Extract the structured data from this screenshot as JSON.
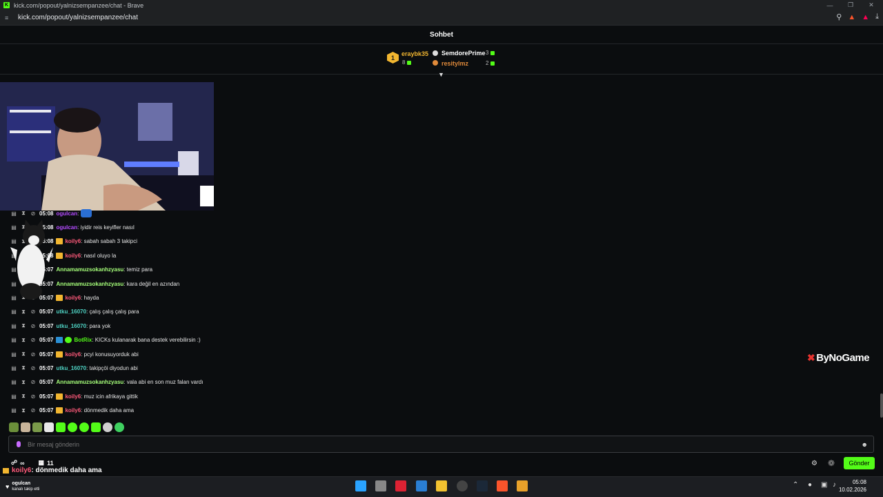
{
  "browser": {
    "title": "kick.com/popout/yalnizsempanzee/chat - Brave",
    "url": "kick.com/popout/yalnizsempanzee/chat"
  },
  "chat": {
    "header": "Sohbet",
    "leaderboard": {
      "rank": "1",
      "top": {
        "name": "eraybk35",
        "count": "8"
      },
      "second": {
        "name": "SemdorePrime",
        "count": "3"
      },
      "third": {
        "name": "resitylmz",
        "count": "2"
      }
    },
    "messages": [
      {
        "time": "05:08",
        "user": "ogulcan",
        "text": "",
        "color": "#b44cff",
        "badge": "none"
      },
      {
        "time": "05:08",
        "user": "ogulcan",
        "text": "iyidir reis keyifler nasıl",
        "color": "#b44cff",
        "badge": "none"
      },
      {
        "time": "05:08",
        "user": "koily6",
        "text": "sabah sabah 3 takipci",
        "color": "#ff5a7a",
        "badge": "crown"
      },
      {
        "time": "05:08",
        "user": "koily6",
        "text": "nasıl oluyo la",
        "color": "#ff5a7a",
        "badge": "crown"
      },
      {
        "time": "05:07",
        "user": "Annamamuzsokanhzyasu",
        "text": "temiz para",
        "color": "#a6ff7a",
        "badge": "none"
      },
      {
        "time": "05:07",
        "user": "Annamamuzsokanhzyasu",
        "text": "kara değil en azından",
        "color": "#a6ff7a",
        "badge": "none"
      },
      {
        "time": "05:07",
        "user": "koily6",
        "text": "hayda",
        "color": "#ff5a7a",
        "badge": "crown"
      },
      {
        "time": "05:07",
        "user": "utku_16070",
        "text": "çalış çalış çalış para",
        "color": "#4fd3c4",
        "badge": "none"
      },
      {
        "time": "05:07",
        "user": "utku_16070",
        "text": "para yok",
        "color": "#4fd3c4",
        "badge": "none"
      },
      {
        "time": "05:07",
        "user": "BotRix",
        "text": "KICKs kulanarak bana destek verebilirsin :)",
        "color": "#53fc18",
        "badge": "bot"
      },
      {
        "time": "05:07",
        "user": "koily6",
        "text": "pcyi konusuyorduk abi",
        "color": "#ff5a7a",
        "badge": "crown"
      },
      {
        "time": "05:07",
        "user": "utku_16070",
        "text": "takipçöi diyodun abi",
        "color": "#4fd3c4",
        "badge": "none"
      },
      {
        "time": "05:07",
        "user": "Annamamuzsokanhzyasu",
        "text": "vala abi en son muz falan vardı",
        "color": "#a6ff7a",
        "badge": "none"
      },
      {
        "time": "05:07",
        "user": "koily6",
        "text": "muz icin afrikaya gittik",
        "color": "#ff5a7a",
        "badge": "crown"
      },
      {
        "time": "05:07",
        "user": "koily6",
        "text": "dönmedik daha ama",
        "color": "#ff5a7a",
        "badge": "crown"
      }
    ],
    "input": {
      "placeholder": "Bir mesaj gönderin"
    },
    "send_label": "Gönder"
  },
  "overlay": {
    "viewer_count": "11",
    "last_user": "koily6",
    "last_text": ": dönmedik daha ama",
    "brand": "ByNoGame"
  },
  "notification": {
    "user": "ogulcan",
    "text": "kanalı takip etti"
  },
  "taskbar": {
    "time": "05:08",
    "date": "10.02.2026"
  },
  "colors": {
    "accent": "#53fc18",
    "background": "#0b0d0f"
  }
}
